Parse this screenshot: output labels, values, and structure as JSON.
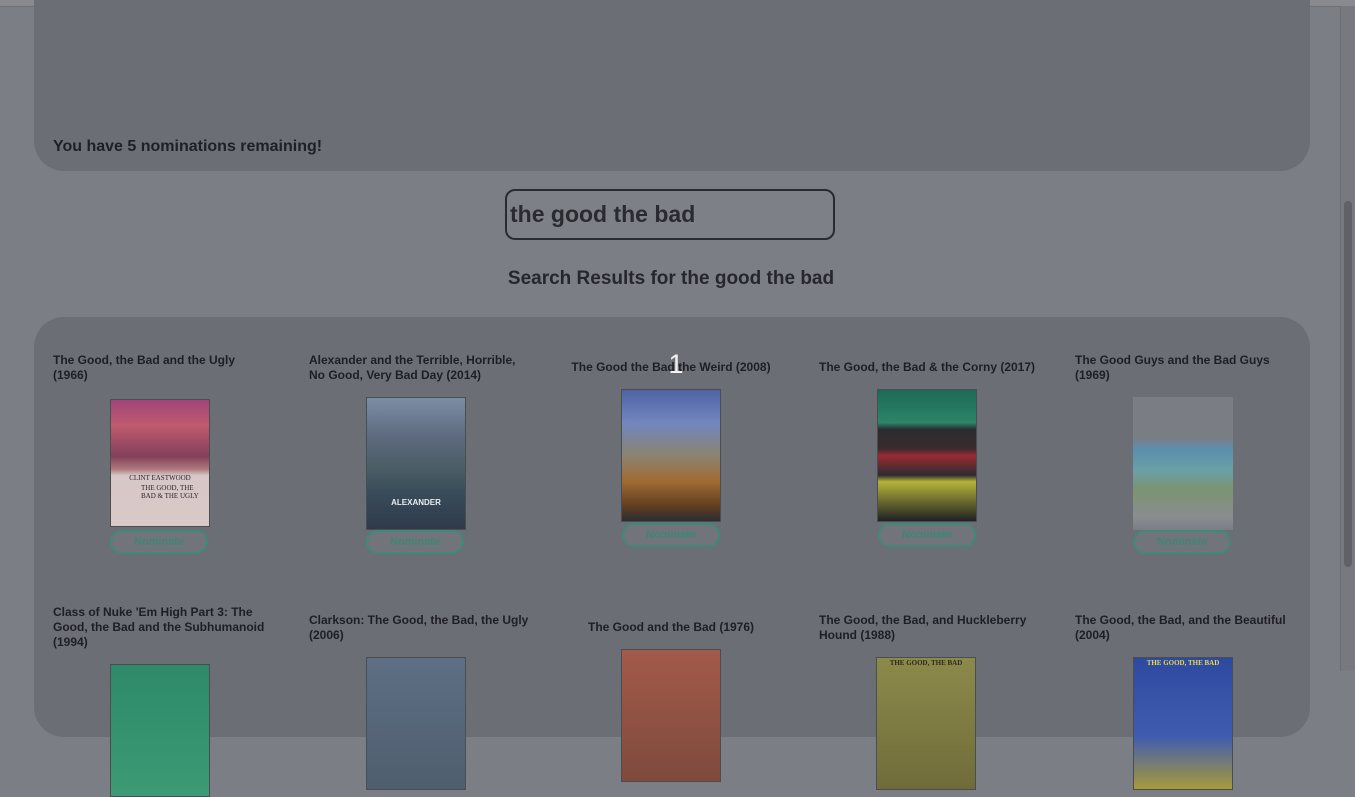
{
  "nominations": {
    "remaining_text": "You have 5 nominations remaining!"
  },
  "search": {
    "value": "the good the bad"
  },
  "results": {
    "title": "Search Results for the good the bad",
    "nominate_label": "Nominate",
    "items": [
      {
        "title": "The Good, the Bad and the Ugly (1966)",
        "poster_text_1": "CLINT EASTWOOD",
        "poster_text_2": "THE GOOD, THE BAD & THE UGLY"
      },
      {
        "title": "Alexander and the Terrible, Horrible, No Good, Very Bad Day (2014)",
        "poster_text_1": "ALEXANDER"
      },
      {
        "title": "The Good the Bad the Weird (2008)"
      },
      {
        "title": "The Good, the Bad & the Corny (2017)"
      },
      {
        "title": "The Good Guys and the Bad Guys (1969)"
      },
      {
        "title": "Class of Nuke 'Em High Part 3: The Good, the Bad and the Subhumanoid (1994)"
      },
      {
        "title": "Clarkson: The Good, the Bad, the Ugly (2006)"
      },
      {
        "title": "The Good and the Bad (1976)"
      },
      {
        "title": "The Good, the Bad, and Huckleberry Hound (1988)",
        "poster_text_1": "THE GOOD, THE BAD"
      },
      {
        "title": "The Good, the Bad, and the Beautiful (2004)",
        "poster_text_1": "THE GOOD, THE BAD"
      }
    ]
  },
  "overlay": {
    "page_indicator": "1"
  }
}
